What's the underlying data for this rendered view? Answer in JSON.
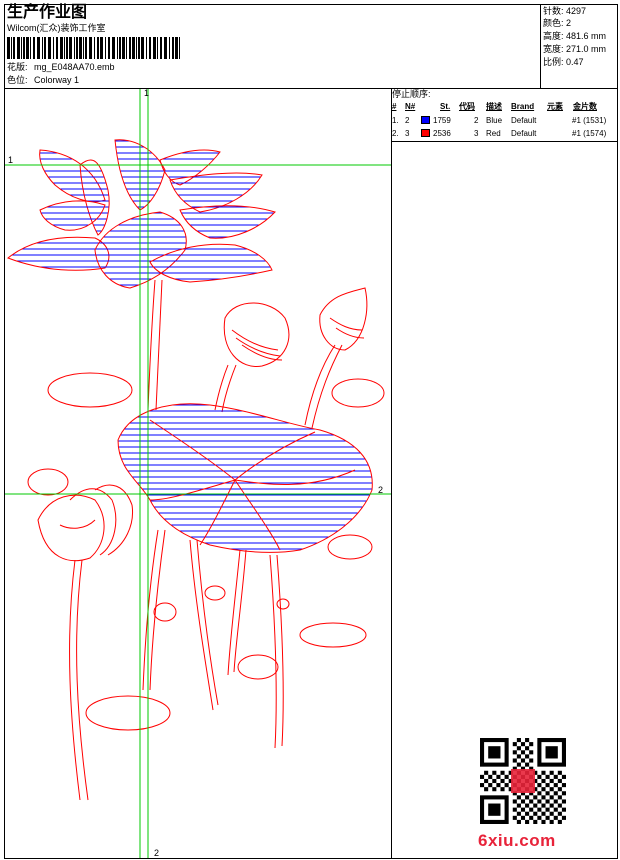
{
  "header": {
    "title": "生产作业图",
    "company": "Wilcom(汇众)装饰工作室",
    "design_label": "花版:",
    "design_file": "mg_E048AA70.emb",
    "colorway_label": "色位:",
    "colorway": "Colorway 1"
  },
  "stats": [
    {
      "label": "针数:",
      "value": "4297"
    },
    {
      "label": "颜色:",
      "value": "2"
    },
    {
      "label": "高度:",
      "value": "481.6 mm"
    },
    {
      "label": "宽度:",
      "value": "271.0 mm"
    },
    {
      "label": "比例:",
      "value": "0.47"
    }
  ],
  "stop_sequence": {
    "title": "停止顺序:",
    "columns": [
      "#",
      "N#",
      "St.",
      "代码",
      "描述",
      "Brand",
      "元素",
      "金片数"
    ],
    "rows": [
      {
        "idx": "1.",
        "n": "2",
        "color": "#0000ff",
        "stitches": "1759",
        "code": "2",
        "desc": "Blue",
        "brand": "Default",
        "element": "#1 (1531)"
      },
      {
        "idx": "2.",
        "n": "3",
        "color": "#ff0000",
        "stitches": "2536",
        "code": "3",
        "desc": "Red",
        "brand": "Default",
        "element": "#1 (1574)"
      }
    ]
  },
  "guides": {
    "v_top": "1",
    "v_bottom": "2",
    "h_left": "1",
    "h_right": "2"
  },
  "colors": {
    "guide_line": "#00c800",
    "outline": "#ff0000",
    "fill": "#0000ff"
  },
  "watermark": {
    "text": "6xiu.com"
  }
}
